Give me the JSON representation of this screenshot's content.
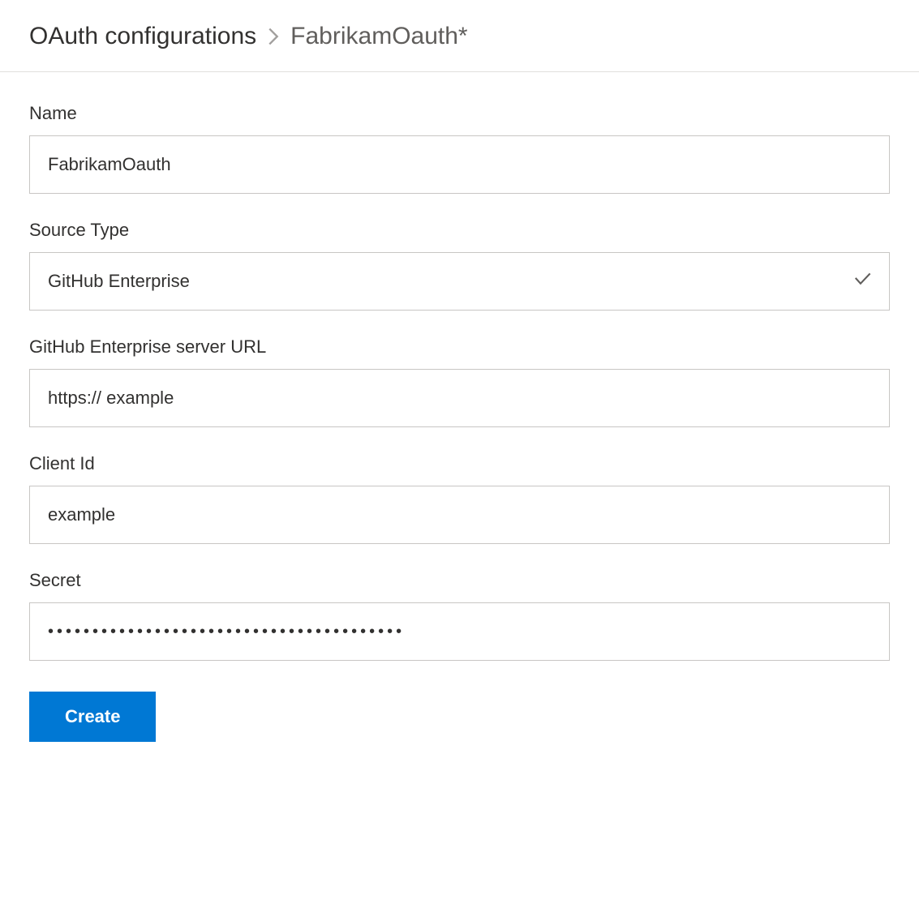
{
  "breadcrumb": {
    "root": "OAuth configurations",
    "current": "FabrikamOauth*"
  },
  "form": {
    "name": {
      "label": "Name",
      "value": "FabrikamOauth"
    },
    "source_type": {
      "label": "Source Type",
      "value": "GitHub Enterprise"
    },
    "server_url": {
      "label": "GitHub Enterprise server URL",
      "value": "https:// example"
    },
    "client_id": {
      "label": "Client Id",
      "value": "example"
    },
    "secret": {
      "label": "Secret",
      "value": "••••••••••••••••••••••••••••••••••••••••"
    },
    "submit_label": "Create"
  }
}
